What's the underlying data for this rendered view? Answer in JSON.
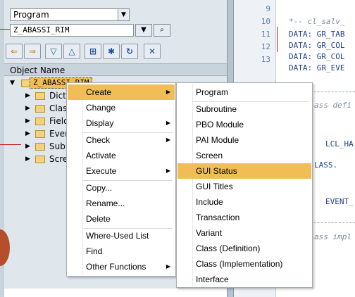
{
  "navigator": {
    "type_combo": {
      "value": "Program"
    },
    "object_field": {
      "value": "Z_ABASSI_RIM"
    },
    "column_header": "Object Name",
    "root": {
      "label": "Z_ABASSI_RIM"
    },
    "tree_items": [
      {
        "label": "Dicti"
      },
      {
        "label": "Class"
      },
      {
        "label": "Field"
      },
      {
        "label": "Event"
      },
      {
        "label": "Subr"
      },
      {
        "label": "Scre"
      }
    ]
  },
  "editor": {
    "line_numbers": [
      "9",
      "10",
      "11",
      "12",
      "13"
    ],
    "lines": [
      "*-- cl_salv_",
      "DATA: GR_TAB",
      "DATA: GR_COL",
      "DATA: GR_COL",
      "DATA: GR_EVE"
    ],
    "fragments": {
      "class_def": "ass defi",
      "lcl_ha": "LCL_HA",
      "lass": "LASS.",
      "event": "EVENT_",
      "class_impl": "ass impl"
    }
  },
  "context_menu": {
    "items": [
      {
        "label": "Create",
        "submenu": true,
        "highlighted": true
      },
      {
        "label": "Change"
      },
      {
        "label": "Display",
        "submenu": true
      },
      {
        "label": "Check",
        "submenu": true
      },
      {
        "label": "Activate"
      },
      {
        "label": "Execute",
        "submenu": true
      },
      {
        "label": "Copy..."
      },
      {
        "label": "Rename..."
      },
      {
        "label": "Delete"
      },
      {
        "label": "Where-Used List"
      },
      {
        "label": "Find"
      },
      {
        "label": "Other Functions",
        "submenu": true
      }
    ]
  },
  "create_submenu": {
    "items": [
      {
        "label": "Program"
      },
      {
        "label": "Subroutine"
      },
      {
        "label": "PBO Module"
      },
      {
        "label": "PAI Module"
      },
      {
        "label": "Screen"
      },
      {
        "label": "GUI Status",
        "highlighted": true
      },
      {
        "label": "GUI Titles"
      },
      {
        "label": "Include"
      },
      {
        "label": "Transaction"
      },
      {
        "label": "Variant"
      },
      {
        "label": "Class (Definition)"
      },
      {
        "label": "Class (Implementation)"
      },
      {
        "label": "Interface"
      }
    ]
  },
  "colors": {
    "highlight": "#f1bd56",
    "annotation_line": "#c0141a",
    "code_blue": "#1f3f86"
  }
}
